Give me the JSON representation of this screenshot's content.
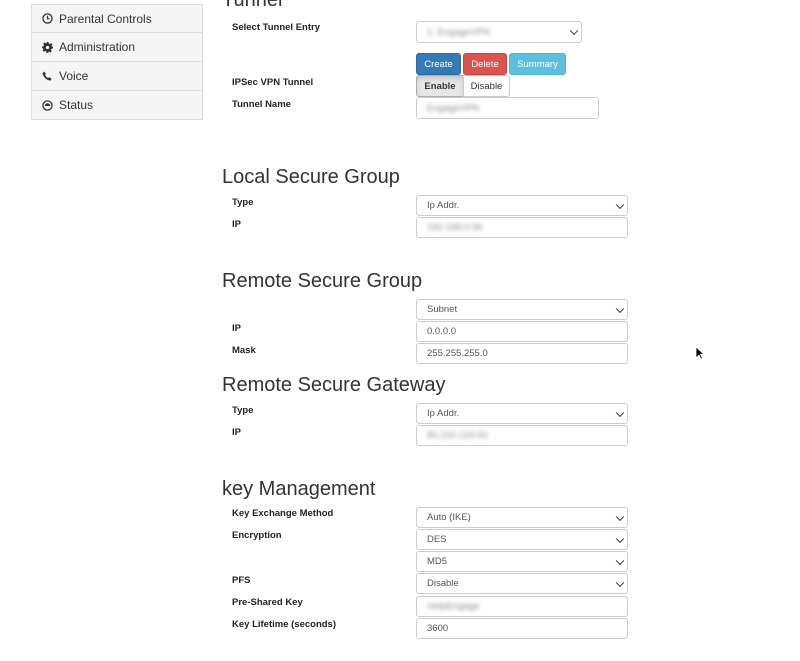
{
  "sidebar": {
    "items": [
      {
        "label": "Parental Controls",
        "icon": "clock-icon"
      },
      {
        "label": "Administration",
        "icon": "gear-icon"
      },
      {
        "label": "Voice",
        "icon": "phone-icon"
      },
      {
        "label": "Status",
        "icon": "gauge-icon"
      }
    ]
  },
  "tunnel": {
    "heading": "Tunnel",
    "select_entry_label": "Select Tunnel Entry",
    "select_entry_value": "1. EngageVPN",
    "create_label": "Create",
    "delete_label": "Delete",
    "summary_label": "Summary",
    "ipsec_label": "IPSec VPN Tunnel",
    "enable_label": "Enable",
    "disable_label": "Disable",
    "tunnel_name_label": "Tunnel Name",
    "tunnel_name_value": "EngageVPN"
  },
  "local": {
    "heading": "Local Secure Group",
    "type_label": "Type",
    "type_value": "Ip Addr.",
    "ip_label": "IP",
    "ip_value": "192.168.0.96"
  },
  "remote_group": {
    "heading": "Remote Secure Group",
    "type_value": "Subnet",
    "ip_label": "IP",
    "ip_value": "0.0.0.0",
    "mask_label": "Mask",
    "mask_value": "255.255.255.0"
  },
  "remote_gateway": {
    "heading": "Remote Secure Gateway",
    "type_label": "Type",
    "type_value": "Ip Addr.",
    "ip_label": "IP",
    "ip_value": "80.210.123.50"
  },
  "key": {
    "heading": "key Management",
    "exchange_label": "Key Exchange Method",
    "exchange_value": "Auto (IKE)",
    "encryption_label": "Encryption",
    "encryption_value": "DES",
    "hash_value": "MD5",
    "pfs_label": "PFS",
    "pfs_value": "Disable",
    "psk_label": "Pre-Shared Key",
    "psk_value": "HelpEngage",
    "lifetime_label": "Key Lifetime (seconds)",
    "lifetime_value": "3600"
  },
  "colors": {
    "create": "#337ab7",
    "delete": "#d9534f",
    "summary": "#5bc0de"
  }
}
